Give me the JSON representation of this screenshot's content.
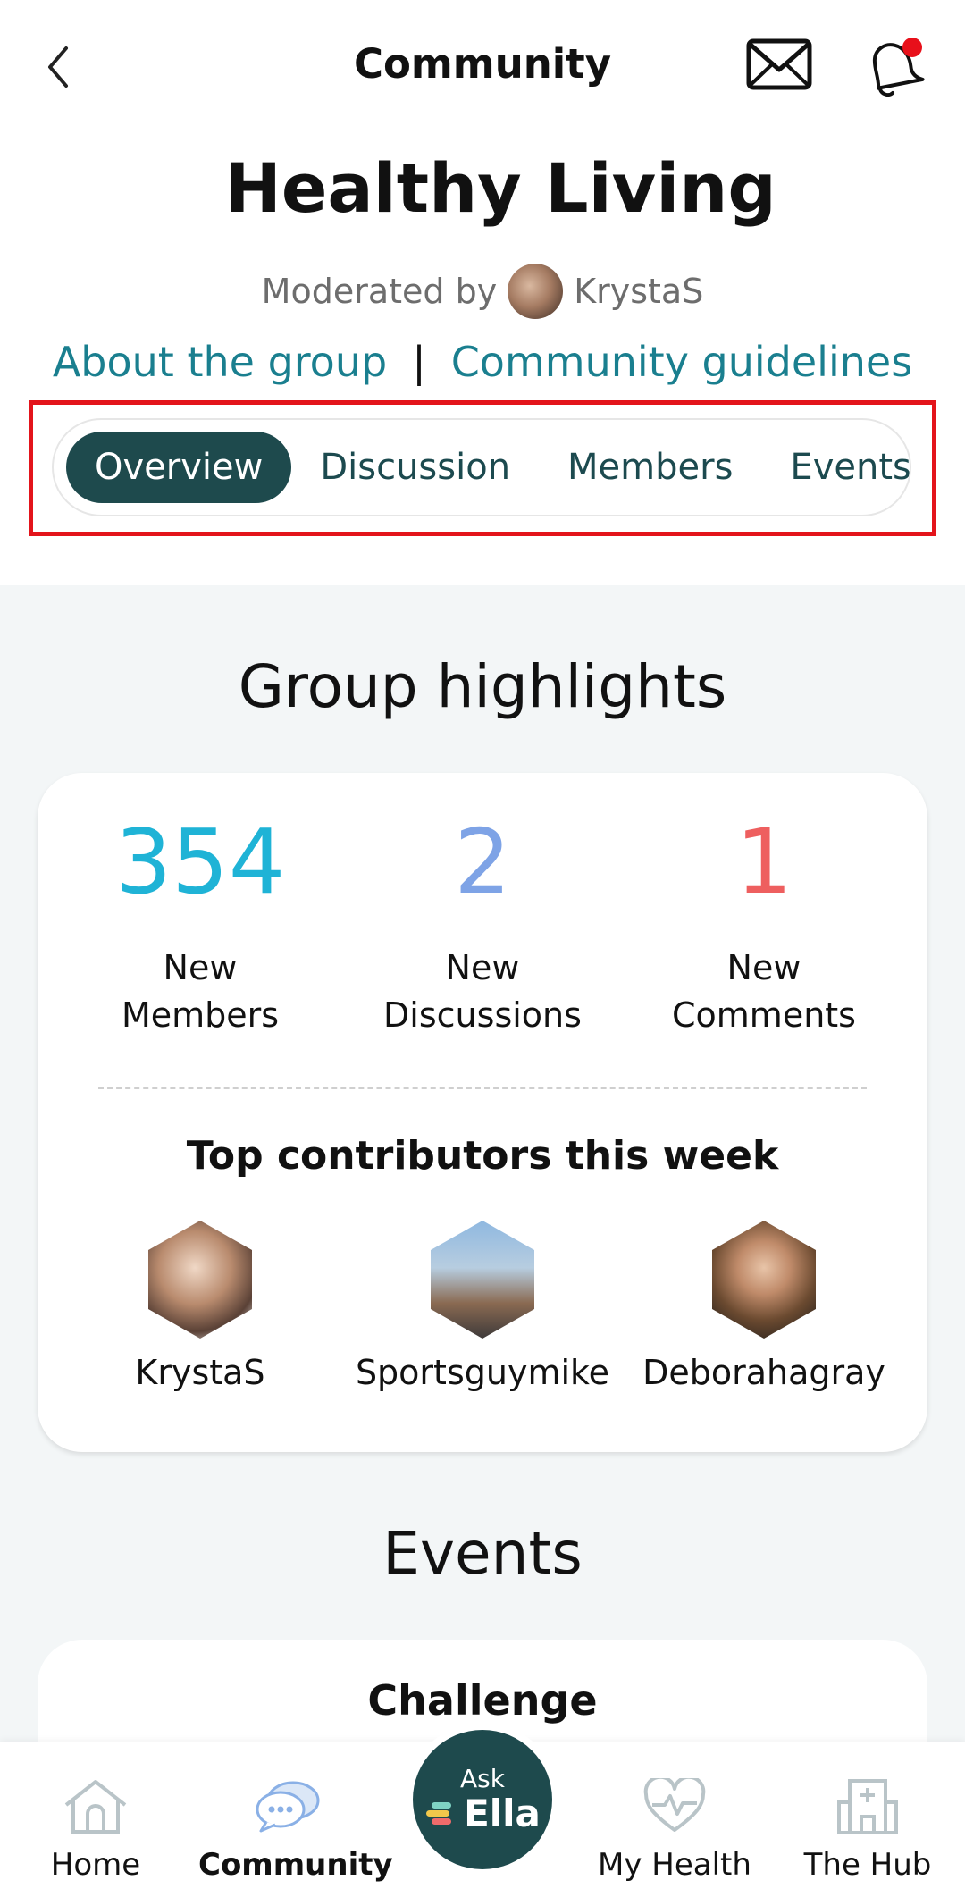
{
  "header": {
    "title": "Community"
  },
  "group": {
    "title": "Healthy Living",
    "moderated_prefix": "Moderated by",
    "moderator": "KrystaS",
    "about_link": "About the group",
    "separator": "|",
    "guidelines_link": "Community guidelines"
  },
  "tabs": [
    {
      "label": "Overview",
      "active": true
    },
    {
      "label": "Discussion",
      "active": false
    },
    {
      "label": "Members",
      "active": false
    },
    {
      "label": "Events",
      "active": false
    }
  ],
  "highlights": {
    "title": "Group highlights",
    "stats": [
      {
        "value": "354",
        "label_line1": "New",
        "label_line2": "Members",
        "color": "#1fb3d6"
      },
      {
        "value": "2",
        "label_line1": "New",
        "label_line2": "Discussions",
        "color": "#7ea3e6"
      },
      {
        "value": "1",
        "label_line1": "New",
        "label_line2": "Comments",
        "color": "#ee5f5f"
      }
    ],
    "top_contributors_title": "Top contributors this week",
    "contributors": [
      {
        "name": "KrystaS"
      },
      {
        "name": "Sportsguymike"
      },
      {
        "name": "Deborahagray"
      }
    ]
  },
  "events": {
    "title": "Events",
    "card_title": "Challenge"
  },
  "bottom_nav": {
    "home": "Home",
    "community": "Community",
    "ask_small": "Ask",
    "ask_big": "Ella",
    "my_health": "My Health",
    "the_hub": "The Hub"
  },
  "colors": {
    "accent_dark": "#1e4a4d",
    "link": "#1a7f8f",
    "highlight_border": "#e3141b",
    "notification": "#e8101a"
  }
}
